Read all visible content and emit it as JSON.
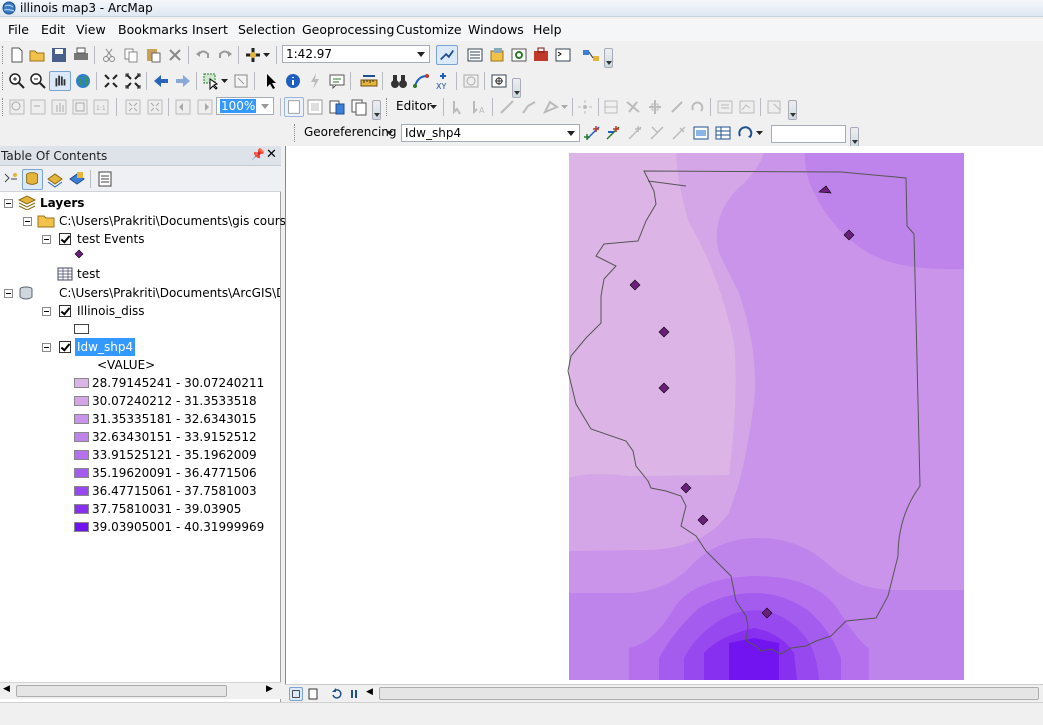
{
  "window": {
    "title": "illinois map3 - ArcMap"
  },
  "menu": [
    "File",
    "Edit",
    "View",
    "Bookmarks",
    "Insert",
    "Selection",
    "Geoprocessing",
    "Customize",
    "Windows",
    "Help"
  ],
  "toolbar": {
    "scale": "1:42.97",
    "transparency": "100%",
    "editor_label": "Editor",
    "georeferencing_label": "Georeferencing",
    "georef_layer": "Idw_shp4",
    "georef_input": ""
  },
  "toc": {
    "title": "Table Of Contents",
    "layers_label": "Layers",
    "groups": [
      {
        "path": "C:\\Users\\Prakriti\\Documents\\gis course"
      },
      {
        "path": "C:\\Users\\Prakriti\\Documents\\ArcGIS\\Defa"
      }
    ],
    "items": {
      "test_events": "test Events",
      "test_table": "test",
      "illinois_diss": "Illinois_diss",
      "idw": "Idw_shp4",
      "value_header": "<VALUE>"
    },
    "legend": [
      {
        "label": "28.79145241 - 30.07240211",
        "color": "#dcb5e6"
      },
      {
        "label": "30.07240212 - 31.3533518",
        "color": "#d5a6e7"
      },
      {
        "label": "31.35335181 - 32.6343015",
        "color": "#c994e9"
      },
      {
        "label": "32.63430151 - 33.9152512",
        "color": "#bf84eb"
      },
      {
        "label": "33.91525121 - 35.1962009",
        "color": "#b470ed"
      },
      {
        "label": "35.19620091 - 36.4771506",
        "color": "#a35cee"
      },
      {
        "label": "36.47715061 - 37.7581003",
        "color": "#9748ef"
      },
      {
        "label": "37.75810031 - 39.03905",
        "color": "#8730f0"
      },
      {
        "label": "39.03905001 - 40.31999969",
        "color": "#7214f0"
      }
    ]
  },
  "colors": {
    "selection": "#3399ff",
    "point_fill": "#6b1f7a",
    "boundary": "#555555"
  }
}
